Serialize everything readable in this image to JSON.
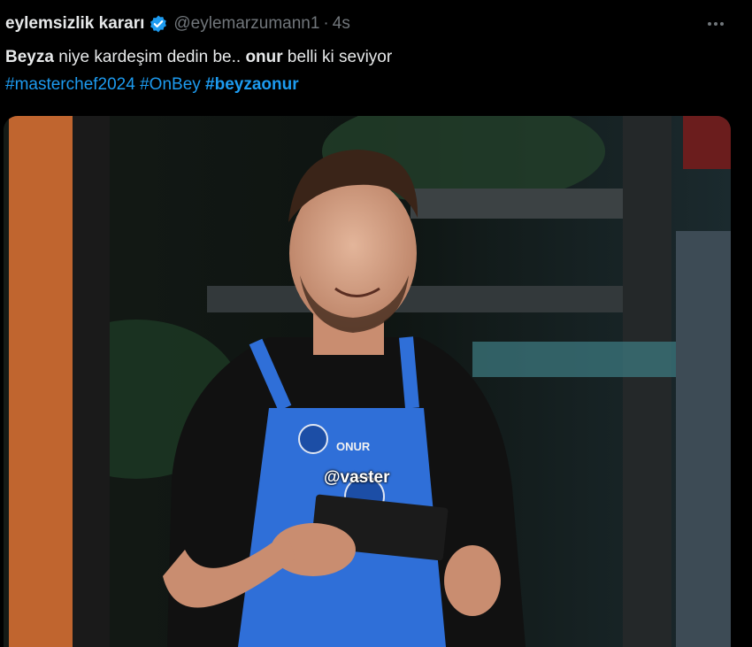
{
  "tweet": {
    "display_name": "eylemsizlik kararı",
    "handle": "@eylemarzumann1",
    "separator": "·",
    "time": "4s",
    "text_parts": {
      "name1": "Beyza",
      "middle": " niye kardeşim dedin be.. ",
      "name2": "onur",
      "end": " belli ki seviyor"
    },
    "hashtags": [
      "#masterchef2024",
      "#OnBey",
      "#beyzaonur"
    ]
  },
  "media": {
    "apron_label": "ONUR",
    "watermark": "@vaster"
  },
  "icons": {
    "verified": "verified-badge-icon",
    "more": "more-options-icon"
  },
  "colors": {
    "background": "#000000",
    "text": "#e7e9ea",
    "muted": "#71767b",
    "accent": "#1d9bf0",
    "apron": "#2f6fd8"
  }
}
